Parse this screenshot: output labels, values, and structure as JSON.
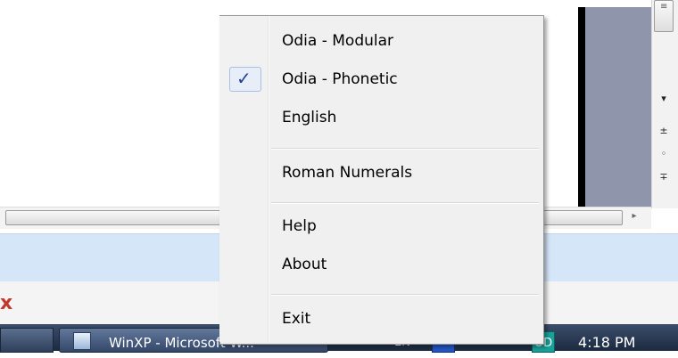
{
  "menu": {
    "items": [
      {
        "label": "Odia - Modular",
        "checked": false
      },
      {
        "label": "Odia - Phonetic",
        "checked": true
      },
      {
        "label": "English",
        "checked": false
      },
      {
        "label": "Roman Numerals",
        "checked": false
      },
      {
        "label": "Help",
        "checked": false
      },
      {
        "label": "About",
        "checked": false
      },
      {
        "label": "Exit",
        "checked": false
      }
    ],
    "check_glyph": "✓"
  },
  "scroll": {
    "up_glyph": "▾",
    "prev_glyph": "±",
    "browse_glyph": "◦",
    "next_glyph": "∓",
    "h_arrow": "▸"
  },
  "taskbar": {
    "task_label": "WinXP - Microsoft W...",
    "lang": "EN",
    "tray_badge": "OD",
    "clock": "4:18 PM"
  },
  "background": {
    "close_mark": "x"
  }
}
